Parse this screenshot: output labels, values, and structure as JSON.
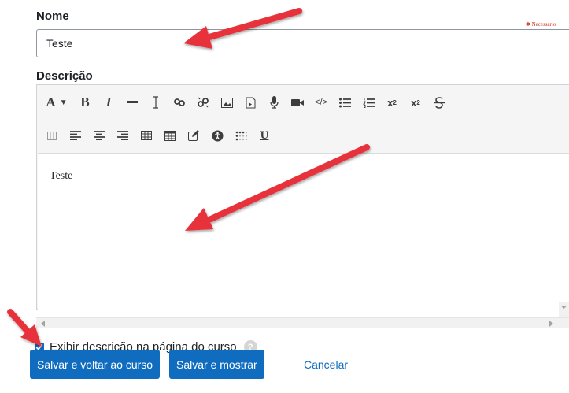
{
  "name_field": {
    "label": "Nome",
    "required_hint": "✱ Necessário",
    "value": "Teste"
  },
  "description": {
    "label": "Descrição",
    "toolbar_row1": [
      "font-icon",
      "bold-icon",
      "italic-icon",
      "horizontal-rule-icon",
      "clear-format-icon",
      "link-icon",
      "unlink-icon",
      "image-icon",
      "media-icon",
      "record-audio-icon",
      "record-video-icon",
      "html-icon",
      "bullet-list-icon",
      "numbered-list-icon",
      "subscript-icon",
      "superscript-icon",
      "strikethrough-icon"
    ],
    "toolbar_row2": [
      "table-columns-icon",
      "align-left-icon",
      "align-center-icon",
      "align-right-icon",
      "table-icon",
      "table-grid-icon",
      "edit-icon",
      "accessibility-icon",
      "special-chars-icon",
      "underline-icon"
    ],
    "bold_glyph": "B",
    "italic_glyph": "I",
    "font_glyph": "A",
    "underline_glyph": "U",
    "content": "Teste"
  },
  "show_description": {
    "checked": true,
    "label": "Exibir descrição na página do curso",
    "help": "?"
  },
  "buttons": {
    "save_return": "Salvar e voltar ao curso",
    "save_show": "Salvar e mostrar",
    "cancel": "Cancelar"
  },
  "annotation_color": "#e8303a"
}
